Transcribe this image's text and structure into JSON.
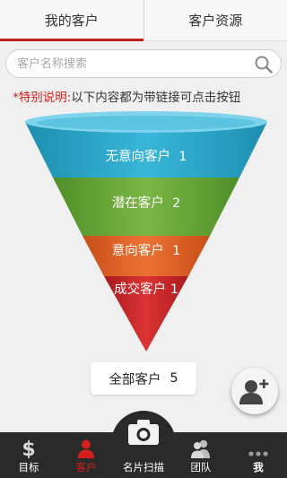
{
  "tabs": [
    {
      "label": "我的客户",
      "active": true
    },
    {
      "label": "客户资源",
      "active": false
    }
  ],
  "search": {
    "placeholder": "客户名称搜索",
    "value": ""
  },
  "notice": {
    "prefix": "*特别说明:",
    "text": "以下内容都为带链接可点击按钮"
  },
  "funnel": [
    {
      "label": "无意向客户",
      "count": "1",
      "color": "#2aa5c6"
    },
    {
      "label": "潜在客户",
      "count": "2",
      "color": "#6ea83a"
    },
    {
      "label": "意向客户",
      "count": "1",
      "color": "#e2642a"
    },
    {
      "label": "成交客户",
      "count": "1",
      "color": "#c9262a"
    }
  ],
  "total": {
    "label": "全部客户",
    "count": "5"
  },
  "fab": {
    "icon": "add-contact-icon"
  },
  "nav": [
    {
      "label": "目标",
      "icon": "dollar-icon",
      "active": false
    },
    {
      "label": "客户",
      "icon": "person-icon",
      "active": true
    },
    {
      "label": "名片扫描",
      "icon": "camera-icon",
      "active": false
    },
    {
      "label": "团队",
      "icon": "team-icon",
      "active": false
    },
    {
      "label": "我",
      "icon": "more-icon",
      "active": false
    }
  ]
}
